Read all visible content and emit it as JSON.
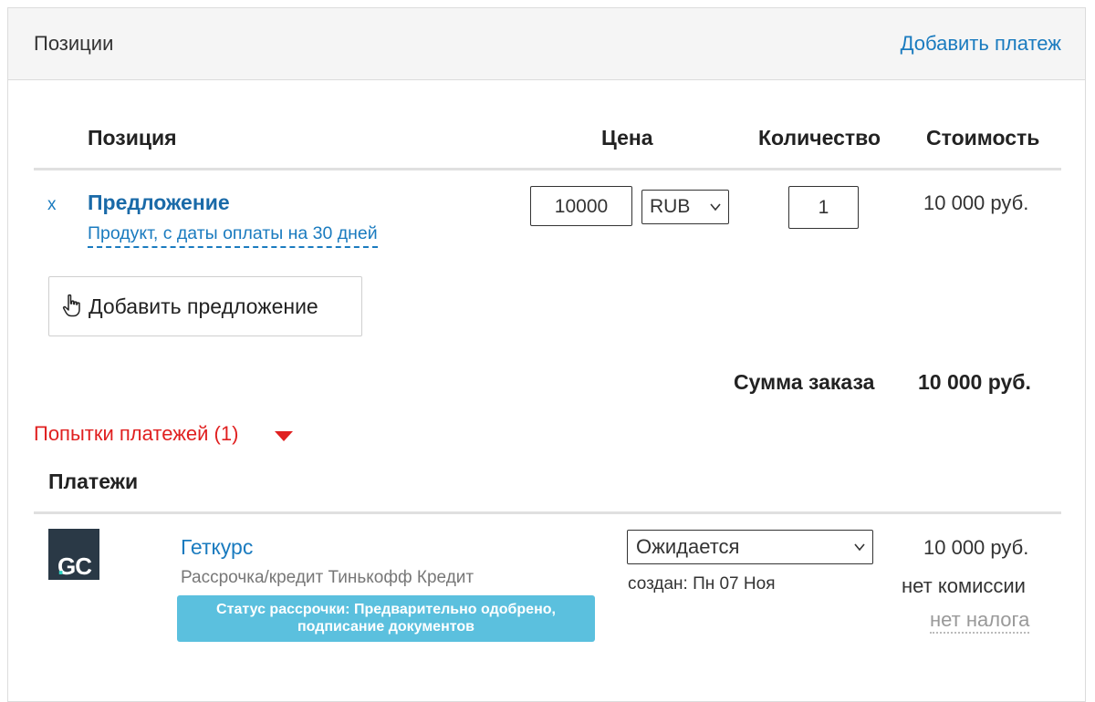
{
  "header": {
    "title": "Позиции",
    "add_payment": "Добавить платеж"
  },
  "table": {
    "columns": [
      "Позиция",
      "Цена",
      "Количество",
      "Стоимость"
    ],
    "rows": [
      {
        "remove": "x",
        "title": "Предложение",
        "subtitle": "Продукт, с даты оплаты на 30 дней",
        "price": "10000",
        "currency": "RUB",
        "quantity": "1",
        "cost": "10 000 руб."
      }
    ]
  },
  "add_offer_button": {
    "label": "Добавить предложение",
    "icon": "hand-pointer-icon"
  },
  "total": {
    "label": "Сумма заказа",
    "value": "10 000 руб."
  },
  "attempts": {
    "label": "Попытки платежей (1)",
    "color": "#e02020"
  },
  "payments": {
    "title": "Платежи",
    "items": [
      {
        "logo_text": "GC",
        "logo_dot": ".",
        "name": "Геткурс",
        "method": "Рассрочка/кредит Тинькофф Кредит",
        "status_badge": "Статус рассрочки: Предварительно одобрено, подписание документов",
        "status": "Ожидается",
        "created": "создан: Пн 07 Ноя",
        "amount": "10 000 руб.",
        "commission": "нет комиссии",
        "tax": "нет налога"
      }
    ]
  },
  "colors": {
    "link": "#1a7bbf",
    "badge": "#5bc0de",
    "logo_bg": "#2a3946",
    "logo_accent": "#2fd2c2"
  }
}
